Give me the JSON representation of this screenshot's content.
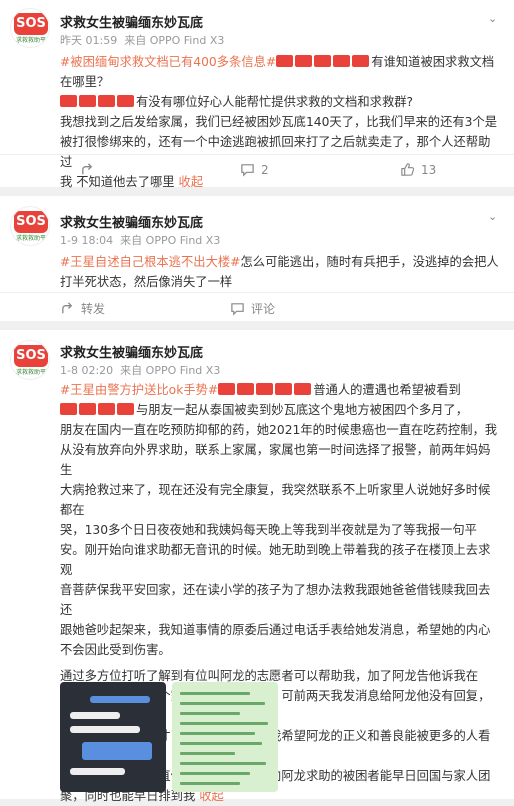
{
  "posts": [
    {
      "username": "求救女生被骗缅东妙瓦底",
      "time": "昨天 01:59",
      "source": "来自 OPPO Find X3",
      "tag": "#被困缅甸求救文档已有400多条信息#",
      "lines": [
        {
          "after_redact": "有谁知道被困求救文档"
        },
        {
          "text": "在哪里？"
        },
        {
          "after_redact": "有没有哪位好心人能帮忙提供求救的文档和求救群?"
        },
        {
          "text": "我想找到之后发给家属，我们已经被困妙瓦底140天了，比我们早来的还有3个是"
        },
        {
          "text": "被打很惨绑来的，还有一个中途逃跑被抓回来打了之后就卖走了，那个人还帮助过"
        },
        {
          "text": "我   不知道他去了哪里"
        }
      ],
      "collapse": "收起",
      "share": "",
      "comments": "2",
      "likes": "13"
    },
    {
      "username": "求救女生被骗缅东妙瓦底",
      "time": "1-9 18:04",
      "source": "来自 OPPO Find X3",
      "tag": "#王星自述自己根本逃不出大楼#",
      "line1": "怎么可能逃出，随时有兵把手，没逃掉的会把人",
      "line2": "打半死状态，然后像消失了一样",
      "share": "转发",
      "comments": "评论"
    },
    {
      "username": "求救女生被骗缅东妙瓦底",
      "time": "1-8 02:20",
      "source": "来自 OPPO Find X3",
      "tag": "#王星由警方护送比ok手势#",
      "line1_tail": "普通人的遭遇也希望被看到",
      "line2_tail": "与朋友一起从泰国被卖到妙瓦底这个鬼地方被困四个多月了，",
      "para1": [
        "朋友在国内一直在吃预防抑郁的药，她2021年的时候患癌也一直在吃药控制，我",
        "从没有放弃向外界求助，联系上家属，家属也第一时间选择了报警，前两年妈妈生",
        "大病抢救过来了，现在还没有完全康复，我突然联系不上听家里人说她好多时候都在",
        "哭，130多个日日夜夜她和我姨妈每天晚上等我到半夜就是为了等我报一句平",
        "安。刚开始向谁求助都无音讯的时候。她无助到晚上带着我的孩子在楼顶上去求观",
        "音菩萨保我平安回家，还在读小学的孩子为了想办法救我跟她爸爸借钱赎我回去还",
        "跟她爸吵起架来，我知道事情的原委后通过电话手表给她发消息，希望她的内心",
        "不会因此受到伤害。"
      ],
      "para2": [
        "通过多方位打听了解到有位叫阿龙的志愿者可以帮助我，加了阿龙告他诉我在",
        "我的前面还有几十个家属的求助在排队，可前两天我发消息给阿龙他没有回复，后",
        "面通过他的朋友圈才了解到他生病了，我希望阿龙的正义和善良能被更多的人看到",
        "，希望他的身体一直健康康康，也希望向阿龙求助的被困者能早日回国与家人团",
        "聚，同时也能早日排到我"
      ],
      "collapse": "收起",
      "images": [
        {
          "name": "chat-screenshot",
          "bg": "#2a2f38"
        },
        {
          "name": "document-screenshot",
          "bg": "#d8f0cf"
        }
      ]
    }
  ],
  "avatar": {
    "sos": "SOS",
    "sub": "求救救助平"
  },
  "colors": {
    "accent": "#eb7350",
    "redact": "#e8423a"
  }
}
